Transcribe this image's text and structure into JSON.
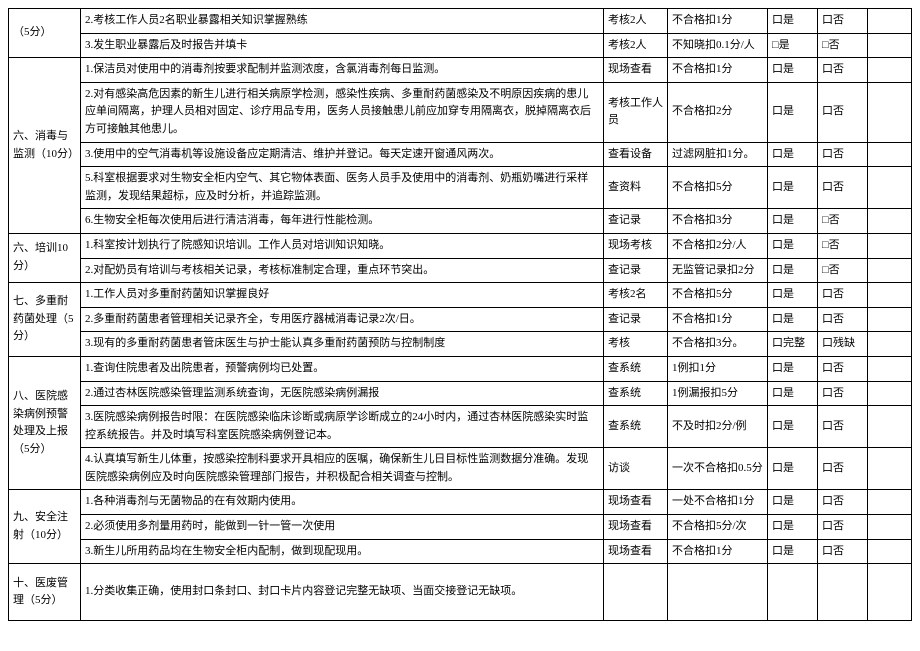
{
  "checkbox_yes": "口是",
  "checkbox_no": "口否",
  "checkbox_complete": "口完整",
  "checkbox_incomplete": "口残缺",
  "checkbox_yes_box": "□是",
  "checkbox_no_box": "□否",
  "sections": {
    "s5": "（5分）",
    "s6a": "六、消毒与监测（10分）",
    "s6b": "六、培训10分）",
    "s7": "七、多重耐药菌处理（5分）",
    "s8": "八、医院感染病例预警处理及上报（5分）",
    "s9": "九、安全注射（10分）",
    "s10": "十、医废管理（5分）"
  },
  "rows": [
    {
      "num": "2.",
      "text": "考核工作人员2名职业暴露相关知识掌握熟练",
      "method": "考核2人",
      "penalty": "不合格扣1分"
    },
    {
      "num": "3.",
      "text": "发生职业暴露后及时报告并填卡",
      "method": "考核2人",
      "penalty": "不知晓扣0.1分/人"
    },
    {
      "num": "1.",
      "text": "保洁员对使用中的消毒剂按要求配制并监测浓度，含氯消毒剂每日监测。",
      "method": "现场查看",
      "penalty": "不合格扣1分"
    },
    {
      "num": "2.",
      "text": "对有感染高危因素的新生儿进行相关病原学检测，感染性疾病、多重耐药菌感染及不明原因疾病的患儿应单间隔离，护理人员相对固定、诊疗用品专用，医务人员接触患儿前应加穿专用隔离衣，脱掉隔离衣后方可接触其他患儿。",
      "method": "考核工作人员",
      "penalty": "不合格扣2分"
    },
    {
      "num": "3.",
      "text": "使用中的空气消毒机等设施设备应定期清洁、维护并登记。每天定速开窗通风两次。",
      "method": "查看设备",
      "penalty": "过滤网脏扣1分。"
    },
    {
      "num": "5.",
      "text": "科室根据要求对生物安全柜内空气、其它物体表面、医务人员手及使用中的消毒剂、奶瓶奶嘴进行采样监测，发现结果超标，应及时分析，并追踪监测。",
      "method": "查资料",
      "penalty": "不合格扣5分"
    },
    {
      "num": "6.",
      "text": "生物安全柜每次使用后进行清洁消毒，每年进行性能检测。",
      "method": "查记录",
      "penalty": "不合格扣3分"
    },
    {
      "num": "1.",
      "text": "科室按计划执行了院感知识培训。工作人员对培训知识知晓。",
      "method": "现场考核",
      "penalty": "不合格扣2分/人"
    },
    {
      "num": "2.",
      "text": "对配奶员有培训与考核相关记录，考核标准制定合理，重点环节突出。",
      "method": "查记录",
      "penalty": "无监管记录扣2分"
    },
    {
      "num": "1.",
      "text": "工作人员对多重耐药菌知识掌握良好",
      "method": "考核2名",
      "penalty": "不合格扣5分"
    },
    {
      "num": "2.",
      "text": "多重耐药菌患者管理相关记录齐全，专用医疗器械消毒记录2次/日。",
      "method": "查记录",
      "penalty": "不合格扣1分"
    },
    {
      "num": "3.",
      "text": "现有的多重耐药菌患者管床医生与护士能认真多重耐药菌预防与控制制度",
      "method": "考核",
      "penalty": "不合格扣3分。"
    },
    {
      "num": "1.",
      "text": "查询住院患者及出院患者，预警病例均已处置。",
      "method": "查系统",
      "penalty": "1例扣1分"
    },
    {
      "num": "2.",
      "text": "通过杏林医院感染管理监测系统查询，无医院感染病例漏报",
      "method": "查系统",
      "penalty": "1例漏报扣5分"
    },
    {
      "num": "3.",
      "text": "医院感染病例报告时限：在医院感染临床诊断或病原学诊断成立的24小时内，通过杏林医院感染实时监控系统报告。并及时填写科室医院感染病例登记本。",
      "method": "查系统",
      "penalty": "不及时扣2分/例"
    },
    {
      "num": "4.",
      "text": "认真填写新生儿体重，按感染控制科要求开具相应的医嘱，确保新生儿日目标性监测数据分准确。发现医院感染病例应及时向医院感染管理部门报告，并积极配合相关调查与控制。",
      "method": "访谈",
      "penalty": "一次不合格扣0.5分"
    },
    {
      "num": "1.",
      "text": "各种消毒剂与无菌物品的在有效期内使用。",
      "method": "现场查看",
      "penalty": "一处不合格扣1分"
    },
    {
      "num": "2.",
      "text": "必须使用多剂量用药时，能做到一针一管一次使用",
      "method": "现场查看",
      "penalty": "不合格扣5分/次"
    },
    {
      "num": "3.",
      "text": "新生儿所用药品均在生物安全柜内配制，做到现配现用。",
      "method": "现场查看",
      "penalty": "不合格扣1分"
    },
    {
      "num": "1.",
      "text": "分类收集正确，使用封口条封口、封口卡片内容登记完整无缺项、当面交接登记无缺项。",
      "method": "",
      "penalty": ""
    }
  ]
}
